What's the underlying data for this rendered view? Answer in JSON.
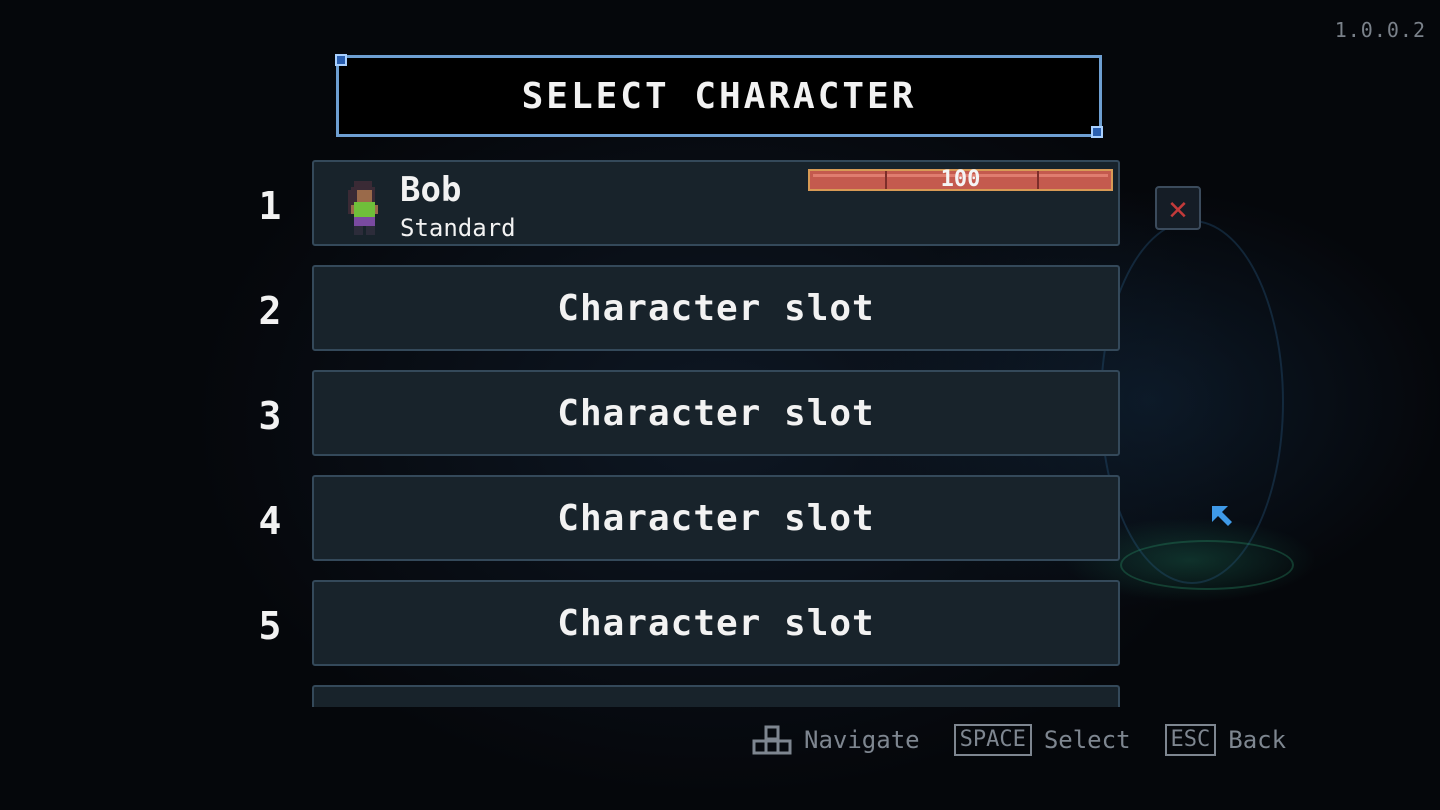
{
  "version": "1.0.0.2",
  "title": "SELECT CHARACTER",
  "slots": [
    {
      "number": "1",
      "name": "Bob",
      "type": "Standard",
      "level": "100",
      "progress": 1.0
    },
    {
      "number": "2",
      "label": "Character slot"
    },
    {
      "number": "3",
      "label": "Character slot"
    },
    {
      "number": "4",
      "label": "Character slot"
    },
    {
      "number": "5",
      "label": "Character slot"
    }
  ],
  "hints": {
    "navigate": "Navigate",
    "space_key": "SPACE",
    "select": "Select",
    "esc_key": "ESC",
    "back": "Back"
  },
  "colors": {
    "accent": "#6e9fd2",
    "slot_bg": "#18232b",
    "health": "#c45a4e",
    "delete": "#c33a3a"
  },
  "icons": {
    "delete": "close-x-icon",
    "navigate": "dpad-icon",
    "cursor": "arrow-cursor-icon"
  }
}
